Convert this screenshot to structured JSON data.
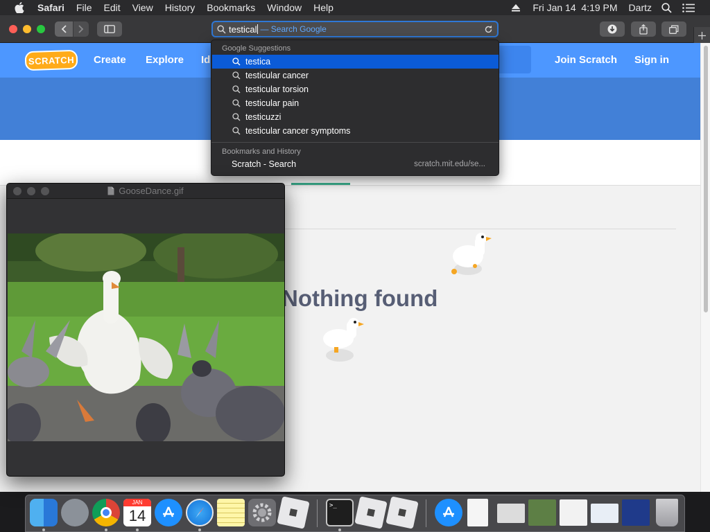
{
  "menubar": {
    "app": "Safari",
    "items": [
      "File",
      "Edit",
      "View",
      "History",
      "Bookmarks",
      "Window",
      "Help"
    ],
    "clock": "Fri Jan 14  4:19 PM",
    "user": "Dartz"
  },
  "browser": {
    "url_typed": "testical",
    "url_hint": "— Search Google"
  },
  "site": {
    "logo": "SCRATCH",
    "nav": [
      "Create",
      "Explore",
      "Id"
    ],
    "join": "Join Scratch",
    "signin": "Sign in",
    "empty_message": "Nothing found"
  },
  "suggestions": {
    "google_header": "Google Suggestions",
    "items": [
      "testica",
      "testicular cancer",
      "testicular torsion",
      "testicular pain",
      "testicuzzi",
      "testicular cancer symptoms"
    ],
    "history_header": "Bookmarks and History",
    "history_title": "Scratch - Search",
    "history_url": "scratch.mit.edu/se..."
  },
  "gif_window": {
    "title": "GooseDance.gif"
  },
  "dock": {
    "calendar_month": "JAN",
    "calendar_day": "14"
  },
  "colors": {
    "scratch_blue": "#4d97ff",
    "banner_blue": "#4280d7",
    "selection_blue": "#0b5bd7",
    "tab_underline": "#3bb08f"
  }
}
